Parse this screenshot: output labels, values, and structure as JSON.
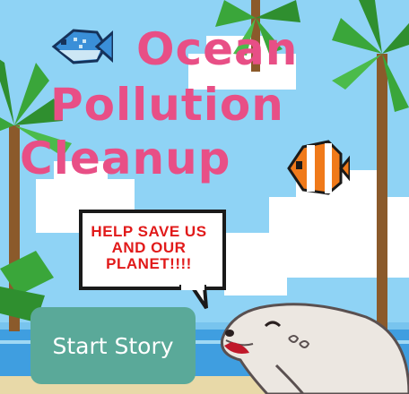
{
  "game": {
    "title_lines": [
      "Ocean",
      "Pollution",
      "Cleanup"
    ],
    "speech_bubble": "HELP SAVE US AND OUR PLANET!!!!",
    "start_button_label": "Start Story"
  },
  "colors": {
    "title_pink": "#e84f86",
    "bubble_text_red": "#e11a1a",
    "button_teal": "#5aa999",
    "sky_blue": "#8fd3f5",
    "sea_blue": "#3f9ee0"
  },
  "icons": [
    "blue-fish-icon",
    "clownfish-icon",
    "seal-icon",
    "palm-tree-icon",
    "cloud-icon"
  ]
}
